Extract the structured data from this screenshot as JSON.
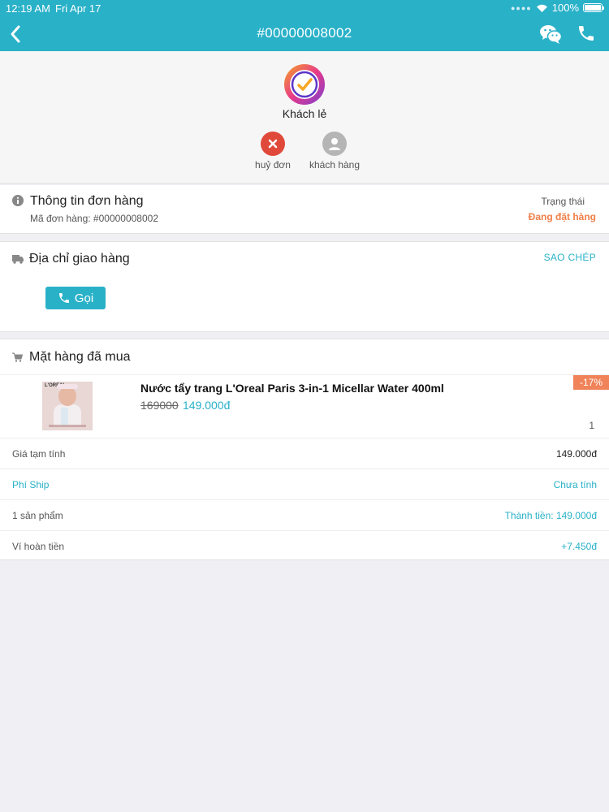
{
  "status_bar": {
    "time": "12:19 AM",
    "date": "Fri Apr 17",
    "battery": "100%"
  },
  "nav": {
    "title": "#00000008002",
    "back_icon": "chevron-left-icon",
    "chat_icon": "wechat-icon",
    "call_icon": "phone-icon"
  },
  "customer": {
    "name": "Khách lẻ",
    "actions": [
      {
        "label": "huỷ đơn",
        "icon": "close-icon",
        "color": "#e0493a"
      },
      {
        "label": "khách hàng",
        "icon": "person-icon",
        "color": "#b5b5b5"
      }
    ]
  },
  "order_info": {
    "heading": "Thông tin đơn hàng",
    "order_code": "Mã đơn hàng: #00000008002",
    "status_label": "Trạng thái",
    "status_value": "Đang đặt hàng"
  },
  "address": {
    "heading": "Địa chỉ giao hàng",
    "copy_label": "SAO CHÉP",
    "call_label": "Gọi"
  },
  "items": {
    "heading": "Mặt hàng đã mua",
    "products": [
      {
        "name": "Nước tẩy trang L'Oreal Paris 3-in-1 Micellar Water 400ml",
        "old_price": "169000",
        "new_price": "149.000đ",
        "discount": "-17%",
        "quantity": "1",
        "thumb_brand": "L'OREAL"
      }
    ],
    "summary": [
      {
        "label": "Giá tạm tính",
        "value": "149.000đ"
      },
      {
        "label": "Phí Ship",
        "value": "Chưa tính"
      },
      {
        "label": "1 sản phẩm",
        "value": "Thành tiền: 149.000đ"
      },
      {
        "label": "Ví hoàn tiền",
        "value": "+7.450đ"
      }
    ]
  },
  "colors": {
    "accent": "#29b1c8",
    "status_orange": "#f07f47",
    "cancel_red": "#e0493a"
  }
}
